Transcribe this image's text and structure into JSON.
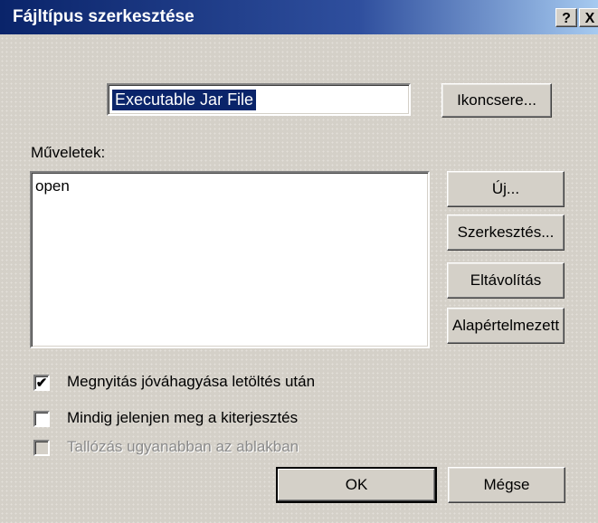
{
  "window": {
    "title": "Fájltípus szerkesztése",
    "help_glyph": "?",
    "close_glyph": "X"
  },
  "file_type": {
    "name_value": "Executable Jar File",
    "change_icon_label": "Ikoncsere..."
  },
  "actions": {
    "label": "Műveletek:",
    "items": [
      "open"
    ],
    "buttons": {
      "new": "Új...",
      "edit": "Szerkesztés...",
      "remove": "Eltávolítás",
      "default": "Alapértelmezett"
    }
  },
  "options": [
    {
      "label": "Megnyitás jóváhagyása letöltés után",
      "checked": true,
      "enabled": true
    },
    {
      "label": "Mindig jelenjen meg a kiterjesztés",
      "checked": false,
      "enabled": true
    },
    {
      "label": "Tallózás ugyanabban az ablakban",
      "checked": false,
      "enabled": false
    }
  ],
  "footer": {
    "ok_label": "OK",
    "cancel_label": "Mégse"
  },
  "colors": {
    "titlebar": "#0a246a",
    "face": "#d4d0c8",
    "selection": "#0a246a"
  }
}
